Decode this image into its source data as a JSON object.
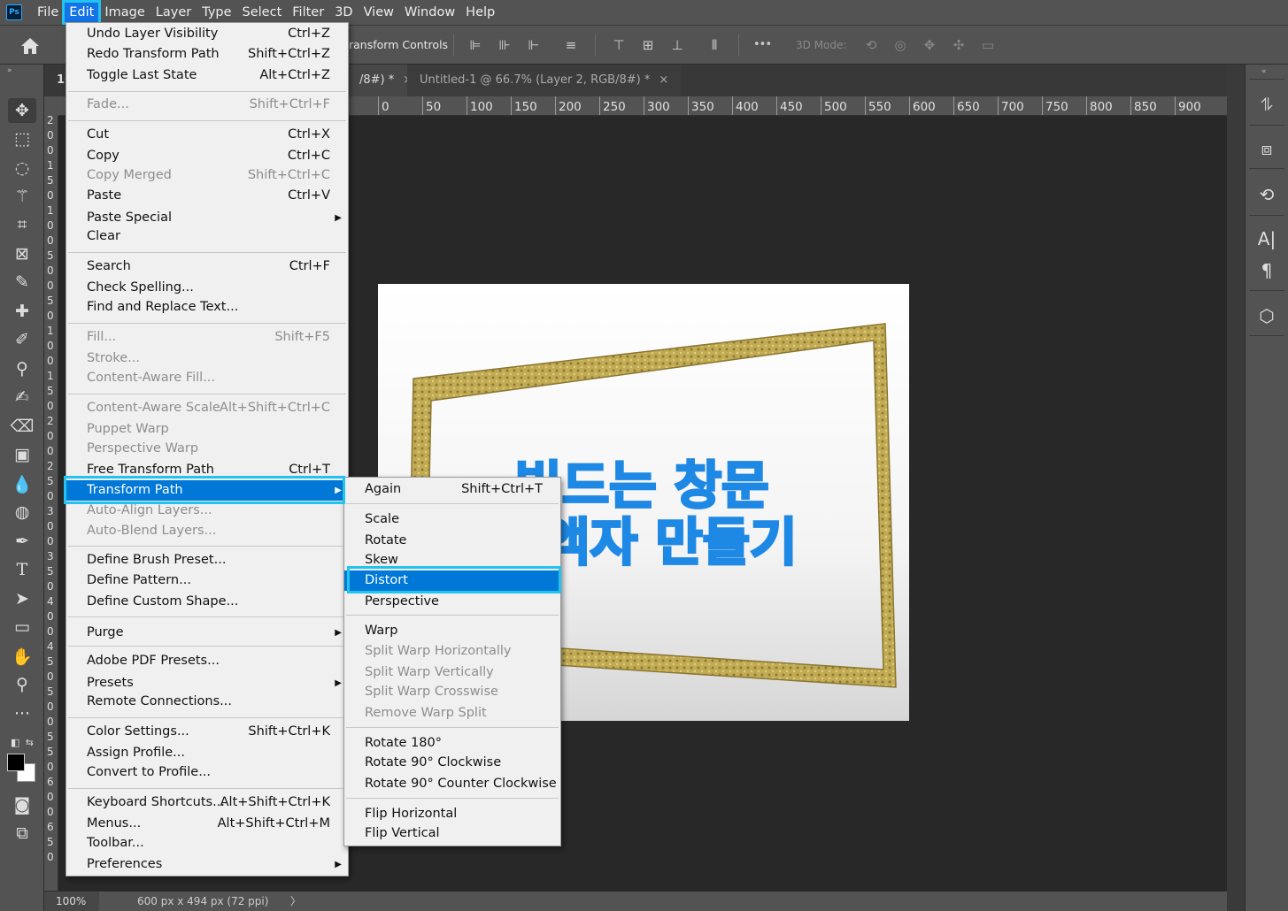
{
  "app": {
    "logo": "Ps"
  },
  "menubar": {
    "items": [
      "File",
      "Edit",
      "Image",
      "Layer",
      "Type",
      "Select",
      "Filter",
      "3D",
      "View",
      "Window",
      "Help"
    ],
    "active": "Edit"
  },
  "options": {
    "label": "ransform Controls",
    "three_d_mode": "3D Mode:",
    "more": "•••"
  },
  "tabs": [
    {
      "label": "16",
      "close": ""
    },
    {
      "label": "/8#) *",
      "close": "×"
    },
    {
      "label": "Untitled-1 @ 66.7% (Layer 2, RGB/8#) *",
      "close": "×"
    }
  ],
  "ruler": {
    "h_ticks": [
      "0",
      "50",
      "100",
      "150",
      "200",
      "250",
      "300",
      "350",
      "400",
      "450",
      "500",
      "550",
      "600",
      "650",
      "700",
      "750",
      "800",
      "850",
      "900"
    ],
    "v_digits": [
      "2",
      "0",
      "0",
      "1",
      "5",
      "0",
      "1",
      "0",
      "0",
      "5",
      "0",
      "0",
      "5",
      "0",
      "1",
      "0",
      "0",
      "1",
      "5",
      "0",
      "2",
      "0",
      "0",
      "2",
      "5",
      "0",
      "3",
      "0",
      "0",
      "3",
      "5",
      "0",
      "4",
      "0",
      "0",
      "4",
      "5",
      "0",
      "5",
      "0",
      "0",
      "5",
      "5",
      "0",
      "6",
      "0",
      "0",
      "6",
      "5",
      "0"
    ]
  },
  "canvas": {
    "text_line1": "빛드는 창문",
    "text_line2": "액자 만들기",
    "highlight_color": "#1e88e5",
    "frame_color": "#b8a14a"
  },
  "status": {
    "zoom": "100%",
    "docinfo": "600 px x 494 px (72 ppi)",
    "arrow": "〉"
  },
  "edit_menu": {
    "items": [
      {
        "label": "Undo Layer Visibility",
        "shortcut": "Ctrl+Z"
      },
      {
        "label": "Redo Transform Path",
        "shortcut": "Shift+Ctrl+Z"
      },
      {
        "label": "Toggle Last State",
        "shortcut": "Alt+Ctrl+Z"
      },
      {
        "label": "Fade...",
        "shortcut": "Shift+Ctrl+F"
      },
      {
        "label": "Cut",
        "shortcut": "Ctrl+X"
      },
      {
        "label": "Copy",
        "shortcut": "Ctrl+C"
      },
      {
        "label": "Copy Merged",
        "shortcut": "Shift+Ctrl+C"
      },
      {
        "label": "Paste",
        "shortcut": "Ctrl+V"
      },
      {
        "label": "Paste Special",
        "shortcut": ""
      },
      {
        "label": "Clear",
        "shortcut": ""
      },
      {
        "label": "Search",
        "shortcut": "Ctrl+F"
      },
      {
        "label": "Check Spelling...",
        "shortcut": ""
      },
      {
        "label": "Find and Replace Text...",
        "shortcut": ""
      },
      {
        "label": "Fill...",
        "shortcut": "Shift+F5"
      },
      {
        "label": "Stroke...",
        "shortcut": ""
      },
      {
        "label": "Content-Aware Fill...",
        "shortcut": ""
      },
      {
        "label": "Content-Aware Scale",
        "shortcut": "Alt+Shift+Ctrl+C"
      },
      {
        "label": "Puppet Warp",
        "shortcut": ""
      },
      {
        "label": "Perspective Warp",
        "shortcut": ""
      },
      {
        "label": "Free Transform Path",
        "shortcut": "Ctrl+T"
      },
      {
        "label": "Transform Path",
        "shortcut": ""
      },
      {
        "label": "Auto-Align Layers...",
        "shortcut": ""
      },
      {
        "label": "Auto-Blend Layers...",
        "shortcut": ""
      },
      {
        "label": "Define Brush Preset...",
        "shortcut": ""
      },
      {
        "label": "Define Pattern...",
        "shortcut": ""
      },
      {
        "label": "Define Custom Shape...",
        "shortcut": ""
      },
      {
        "label": "Purge",
        "shortcut": ""
      },
      {
        "label": "Adobe PDF Presets...",
        "shortcut": ""
      },
      {
        "label": "Presets",
        "shortcut": ""
      },
      {
        "label": "Remote Connections...",
        "shortcut": ""
      },
      {
        "label": "Color Settings...",
        "shortcut": "Shift+Ctrl+K"
      },
      {
        "label": "Assign Profile...",
        "shortcut": ""
      },
      {
        "label": "Convert to Profile...",
        "shortcut": ""
      },
      {
        "label": "Keyboard Shortcuts...",
        "shortcut": "Alt+Shift+Ctrl+K"
      },
      {
        "label": "Menus...",
        "shortcut": "Alt+Shift+Ctrl+M"
      },
      {
        "label": "Toolbar...",
        "shortcut": ""
      },
      {
        "label": "Preferences",
        "shortcut": ""
      }
    ]
  },
  "transform_menu": {
    "items": [
      {
        "label": "Again",
        "shortcut": "Shift+Ctrl+T"
      },
      {
        "label": "Scale",
        "shortcut": ""
      },
      {
        "label": "Rotate",
        "shortcut": ""
      },
      {
        "label": "Skew",
        "shortcut": ""
      },
      {
        "label": "Distort",
        "shortcut": ""
      },
      {
        "label": "Perspective",
        "shortcut": ""
      },
      {
        "label": "Warp",
        "shortcut": ""
      },
      {
        "label": "Split Warp Horizontally",
        "shortcut": ""
      },
      {
        "label": "Split Warp Vertically",
        "shortcut": ""
      },
      {
        "label": "Split Warp Crosswise",
        "shortcut": ""
      },
      {
        "label": "Remove Warp Split",
        "shortcut": ""
      },
      {
        "label": "Rotate 180°",
        "shortcut": ""
      },
      {
        "label": "Rotate 90° Clockwise",
        "shortcut": ""
      },
      {
        "label": "Rotate 90° Counter Clockwise",
        "shortcut": ""
      },
      {
        "label": "Flip Horizontal",
        "shortcut": ""
      },
      {
        "label": "Flip Vertical",
        "shortcut": ""
      }
    ]
  }
}
